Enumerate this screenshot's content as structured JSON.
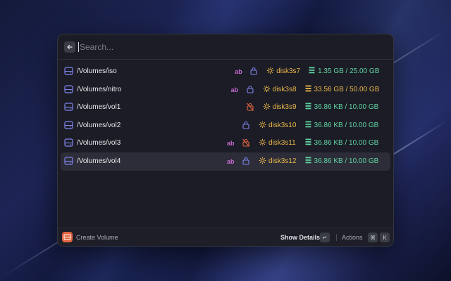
{
  "search": {
    "placeholder": "Search..."
  },
  "volumes": [
    {
      "name": "/Volumes/iso",
      "show_ab": true,
      "lock": "locked",
      "disk": "disk3s7",
      "size": "1.35 GB / 25.00 GB",
      "size_color": "green"
    },
    {
      "name": "/Volumes/nitro",
      "show_ab": true,
      "lock": "locked",
      "disk": "disk3s8",
      "size": "33.56 GB / 50.00 GB",
      "size_color": "orange"
    },
    {
      "name": "/Volumes/vol1",
      "show_ab": false,
      "lock": "unlocked",
      "disk": "disk3s9",
      "size": "36.86 KB / 10.00 GB",
      "size_color": "green"
    },
    {
      "name": "/Volumes/vol2",
      "show_ab": false,
      "lock": "locked",
      "disk": "disk3s10",
      "size": "36.86 KB / 10.00 GB",
      "size_color": "green"
    },
    {
      "name": "/Volumes/vol3",
      "show_ab": true,
      "lock": "unlocked",
      "disk": "disk3s11",
      "size": "36.86 KB / 10.00 GB",
      "size_color": "green"
    },
    {
      "name": "/Volumes/vol4",
      "show_ab": true,
      "lock": "locked",
      "disk": "disk3s12",
      "size": "36.86 KB / 10.00 GB",
      "size_color": "green",
      "selected": true
    }
  ],
  "labels": {
    "ab": "ab"
  },
  "colors": {
    "green": "#62d2a2",
    "orange": "#e9b64a",
    "accent": "#e0643f",
    "lock_blue": "#7f86f0",
    "lock_off": "#e0643f",
    "disk_icon": "#7f86f0"
  },
  "footer": {
    "create_label": "Create Volume",
    "show_details": "Show Details",
    "enter_key": "↵",
    "actions": "Actions",
    "cmd_key": "⌘",
    "k_key": "K"
  }
}
